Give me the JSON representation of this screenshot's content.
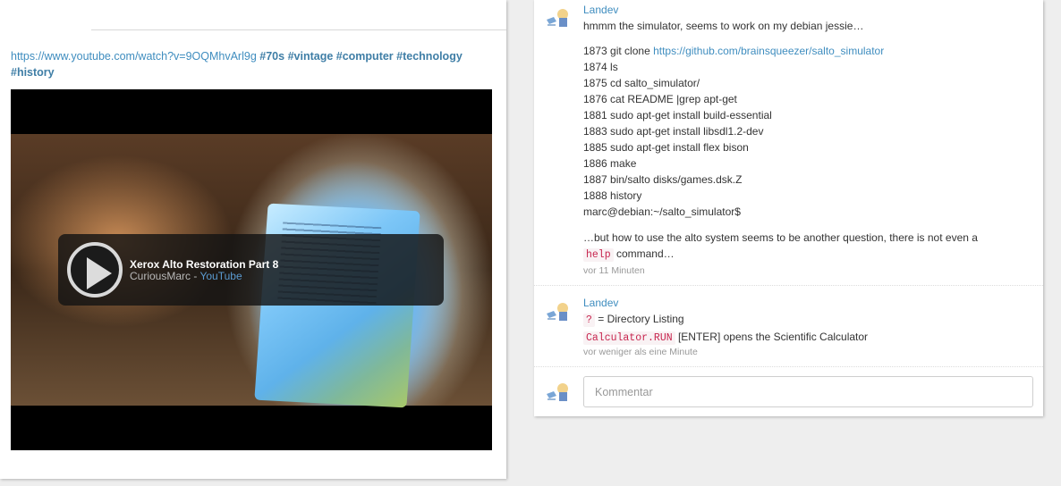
{
  "post": {
    "link": "https://www.youtube.com/watch?v=9OQMhvArl9g",
    "tags": [
      "#70s",
      "#vintage",
      "#computer",
      "#technology",
      "#history"
    ]
  },
  "video": {
    "title": "Xerox Alto Restoration Part 8",
    "channel": "CuriousMarc",
    "separator": " - ",
    "source": "YouTube"
  },
  "comments": [
    {
      "author": "Landev",
      "intro": "hmmm the simulator, seems to work on my debian jessie…",
      "lines": [
        {
          "num": "1873",
          "cmd": "git clone ",
          "link": "https://github.com/brainsqueezer/salto_simulator"
        },
        {
          "num": "1874",
          "cmd": "ls"
        },
        {
          "num": "1875",
          "cmd": "cd salto_simulator/"
        },
        {
          "num": "1876",
          "cmd": "cat README |grep apt-get"
        },
        {
          "num": "1881",
          "cmd": "sudo apt-get install build-essential"
        },
        {
          "num": "1883",
          "cmd": "sudo apt-get install libsdl1.2-dev"
        },
        {
          "num": "1885",
          "cmd": "sudo apt-get install flex bison"
        },
        {
          "num": "1886",
          "cmd": "make"
        },
        {
          "num": "1887",
          "cmd": "bin/salto disks/games.dsk.Z"
        },
        {
          "num": "1888",
          "cmd": "history"
        }
      ],
      "prompt": "marc@debian:~/salto_simulator$",
      "outro_before": "…but how to use the alto system seems to be another question, there is not even a",
      "outro_code": "help",
      "outro_after": " command…",
      "time": "vor 11 Minuten"
    },
    {
      "author": "Landev",
      "line1_code": "?",
      "line1_text": " = Directory Listing",
      "line2_code": "Calculator.RUN",
      "line2_text": " [ENTER] opens the Scientific Calculator",
      "time": "vor weniger als eine Minute"
    }
  ],
  "input": {
    "placeholder": "Kommentar"
  }
}
